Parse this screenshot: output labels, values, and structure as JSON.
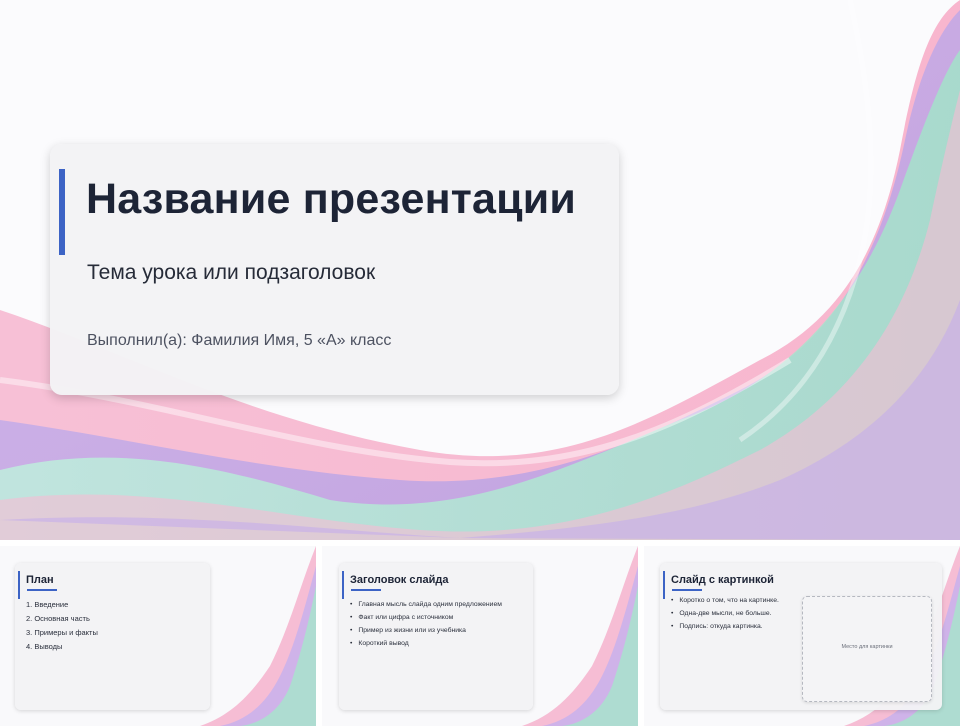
{
  "main_slide": {
    "title": "Название презентации",
    "subtitle": "Тема урока или подзаголовок",
    "author": "Выполнил(а): Фамилия Имя, 5 «А» класс"
  },
  "thumbnails": [
    {
      "title": "План",
      "items": [
        "1. Введение",
        "2. Основная часть",
        "3. Примеры и факты",
        "4. Выводы"
      ]
    },
    {
      "title": "Заголовок слайда",
      "items": [
        "Главная мысль слайда одним предложением",
        "Факт или цифра с источником",
        "Пример из жизни или из учебника",
        "Короткий вывод"
      ]
    },
    {
      "title": "Слайд с картинкой",
      "items": [
        "Коротко о том, что на картинке.",
        "Одна-две мысли, не больше.",
        "Подпись: откуда картинка."
      ],
      "placeholder": "Место для картинки"
    }
  ],
  "colors": {
    "accent": "#3c63c5",
    "title_text": "#1d2436",
    "wave_pink": "#f4a6c4",
    "wave_purple": "#b9a3e6",
    "wave_mint": "#a8e3cd"
  }
}
